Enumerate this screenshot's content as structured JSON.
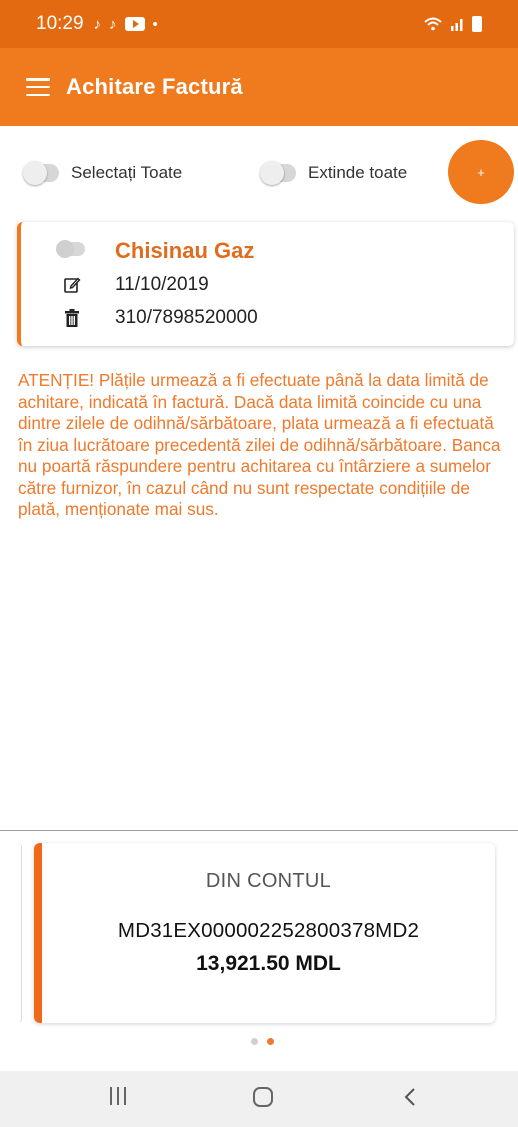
{
  "status_bar": {
    "time": "10:29",
    "notif_icons": [
      "tiktok-icon",
      "tiktok-icon",
      "youtube-icon",
      "dot-icon"
    ]
  },
  "app_bar": {
    "title": "Achitare Factură"
  },
  "controls": {
    "select_all_label": "Selectați Toate",
    "expand_all_label": "Extinde toate",
    "add_label": "+"
  },
  "invoice": {
    "provider": "Chisinau Gaz",
    "date": "11/10/2019",
    "code": "310/7898520000"
  },
  "warning_text": "ATENȚIE! Plățile urmează a fi efectuate până la data limită de achitare, indicată în factură. Dacă data limită coincide cu una dintre zilele de odihnă/sărbătoare, plata urmează a fi efectuată în ziua lucrătoare precedentă zilei de odihnă/sărbătoare. Banca nu poartă răspundere pentru achitarea cu întârziere a sumelor către furnizor, în cazul când nu sunt respectate condițiile de plată, menționate mai sus.",
  "account": {
    "label": "DIN CONTUL",
    "iban": "MD31EX000002252800378MD2",
    "amount": "13,921.50 MDL"
  },
  "pager": {
    "pages": 2,
    "active_page": 2
  },
  "colors": {
    "accent": "#f07a1e",
    "status_bar": "#e46a12",
    "warning_text": "#ef7a2c"
  }
}
